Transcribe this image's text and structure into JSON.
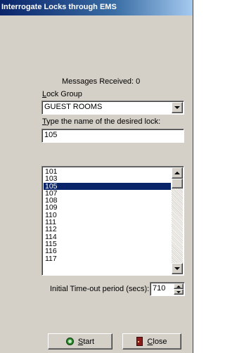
{
  "window": {
    "title": "Interrogate Locks through EMS"
  },
  "messages_received": "Messages Received: 0",
  "lock_group": {
    "label_prefix": "",
    "label_mnemonic": "L",
    "label_rest": "ock Group",
    "selected_value": "GUEST ROOMS"
  },
  "lock_name": {
    "label_mnemonic": "T",
    "label_rest": "ype the name of the desired lock:",
    "value": "105"
  },
  "lock_list": {
    "items": [
      "101",
      "103",
      "105",
      "107",
      "108",
      "109",
      "110",
      "111",
      "112",
      "114",
      "115",
      "116",
      "117"
    ],
    "selected_index": 2
  },
  "timeout": {
    "label": "Initial Time-out period (secs):",
    "value": "710"
  },
  "buttons": {
    "start_mnemonic": "S",
    "start_rest": "tart",
    "close_mnemonic": "C",
    "close_rest": "lose"
  },
  "icons": {
    "start": "start-green-circle-icon",
    "close": "close-door-icon",
    "dropdown": "chevron-down-icon"
  }
}
